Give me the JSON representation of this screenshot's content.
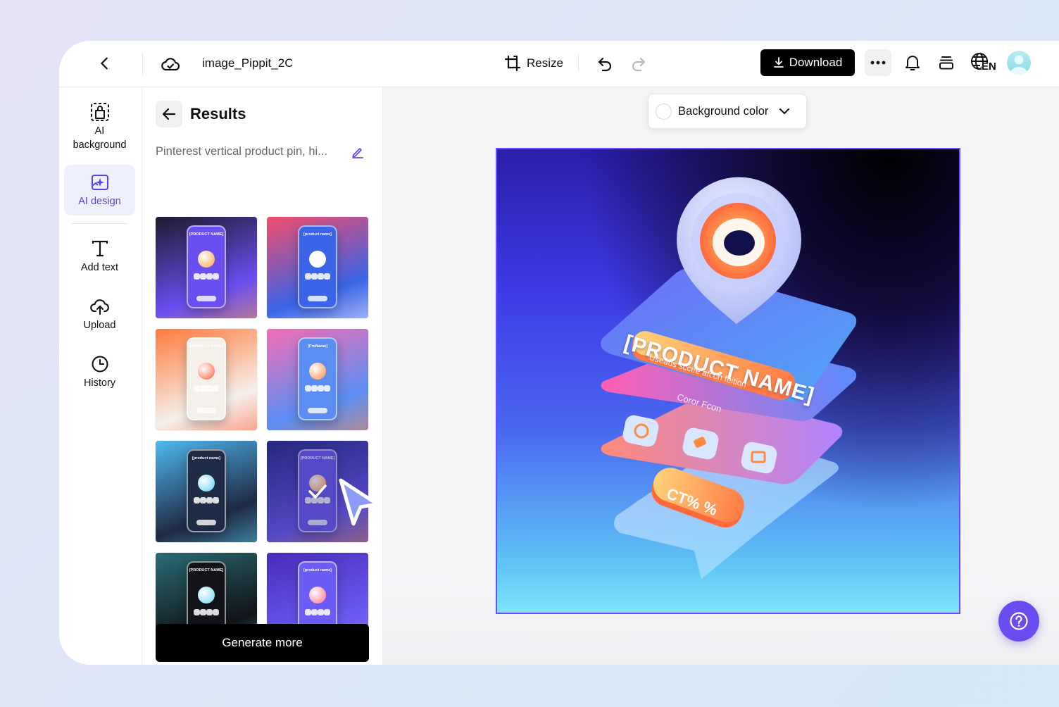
{
  "header": {
    "file_name": "image_Pippit_2C",
    "resize_label": "Resize",
    "download_label": "Download",
    "language_badge": "EN"
  },
  "sidebar": {
    "items": [
      {
        "label": "AI background",
        "icon": "ai-background-icon"
      },
      {
        "label": "AI design",
        "icon": "ai-design-icon",
        "active": true
      },
      {
        "label": "Add text",
        "icon": "text-icon"
      },
      {
        "label": "Upload",
        "icon": "upload-cloud-icon"
      },
      {
        "label": "History",
        "icon": "clock-icon"
      }
    ]
  },
  "results": {
    "title": "Results",
    "prompt": "Pinterest vertical product pin, hi...",
    "generate_label": "Generate more",
    "thumbnails": [
      {
        "caption": "[PRODUCT NAME]",
        "bg": "#1d1b2e",
        "phone": "#6a4ef0",
        "orb": "#ff9f43"
      },
      {
        "caption": "[product name]",
        "bg": "#f24d6b",
        "phone": "#3b64e8",
        "orb": "#ffffff"
      },
      {
        "caption": "[PRODUCT NAME]",
        "bg": "#ff7a3d",
        "phone": "#f5f0ea",
        "orb": "#ff5a36"
      },
      {
        "caption": "[ProName]",
        "bg": "#f56db5",
        "phone": "#5b8df2",
        "orb": "#ff8a3d"
      },
      {
        "caption": "[product name]",
        "bg": "#4fb9f0",
        "phone": "#1f2a44",
        "orb": "#58d0f5"
      },
      {
        "caption": "[PRODUCT NAME]",
        "bg": "#2b2f8f",
        "phone": "#6a5cf0",
        "orb": "#ff9a52",
        "selected": true
      },
      {
        "caption": "[PRODUCT NAME]",
        "bg": "#2a6d76",
        "phone": "#111318",
        "orb": "#6ad7ef"
      },
      {
        "caption": "[product name]",
        "bg": "#4a2bb7",
        "phone": "#6a5cf5",
        "orb": "#ff6b8a"
      }
    ]
  },
  "canvas": {
    "background_color_label": "Background color",
    "design": {
      "headline": "[PRODUCT NAME]",
      "subline": "Useaus sccee afcon feition",
      "caption": "Coror Fcon",
      "cta": "CT% %"
    }
  },
  "colors": {
    "accent": "#4f47e6",
    "help": "#6a4cf0",
    "artboard_border": "#6a4dff"
  }
}
